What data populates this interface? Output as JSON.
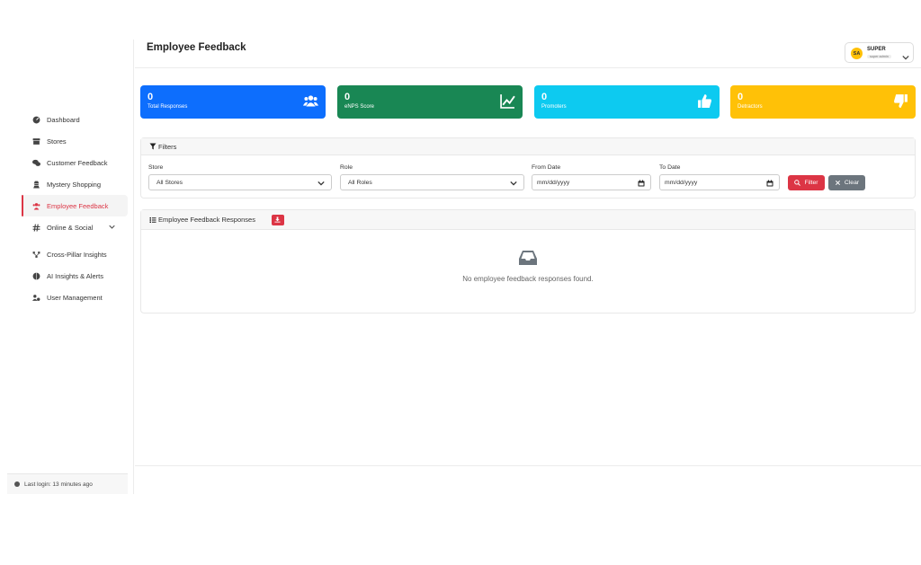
{
  "header": {
    "title": "Employee Feedback",
    "user": {
      "initials": "SA",
      "name": "SUPER",
      "role": "super admin"
    }
  },
  "sidebar": {
    "items": [
      {
        "label": "Dashboard",
        "icon": "dashboard-icon"
      },
      {
        "label": "Stores",
        "icon": "store-icon"
      },
      {
        "label": "Customer Feedback",
        "icon": "comments-icon"
      },
      {
        "label": "Mystery Shopping",
        "icon": "user-secret-icon"
      },
      {
        "label": "Employee Feedback",
        "icon": "users-icon",
        "active": true
      },
      {
        "label": "Online & Social",
        "icon": "hashtag-icon",
        "expandable": true
      },
      {
        "label": "Cross-Pillar Insights",
        "icon": "network-icon"
      },
      {
        "label": "AI Insights & Alerts",
        "icon": "brain-icon"
      },
      {
        "label": "User Management",
        "icon": "users-cog-icon"
      }
    ],
    "last_login": "Last login: 13 minutes ago"
  },
  "stats": [
    {
      "value": "0",
      "label": "Total Responses",
      "color": "#0d6efd",
      "icon": "users-icon"
    },
    {
      "value": "0",
      "label": "eNPS Score",
      "color": "#198754",
      "icon": "chart-line-icon"
    },
    {
      "value": "0",
      "label": "Promoters",
      "color": "#0dcaf0",
      "icon": "thumbs-up-icon"
    },
    {
      "value": "0",
      "label": "Detractors",
      "color": "#ffc107",
      "icon": "thumbs-down-icon"
    }
  ],
  "filters": {
    "title": "Filters",
    "store": {
      "label": "Store",
      "value": "All Stores"
    },
    "role": {
      "label": "Role",
      "value": "All Roles"
    },
    "from_date": {
      "label": "From Date",
      "placeholder": "mm/dd/yyyy"
    },
    "to_date": {
      "label": "To Date",
      "placeholder": "mm/dd/yyyy"
    },
    "filter_button": "Filter",
    "clear_button": "Clear"
  },
  "responses": {
    "title": "Employee Feedback Responses",
    "empty_message": "No employee feedback responses found."
  },
  "colors": {
    "accent": "#dc3545",
    "secondary": "#6c757d"
  }
}
